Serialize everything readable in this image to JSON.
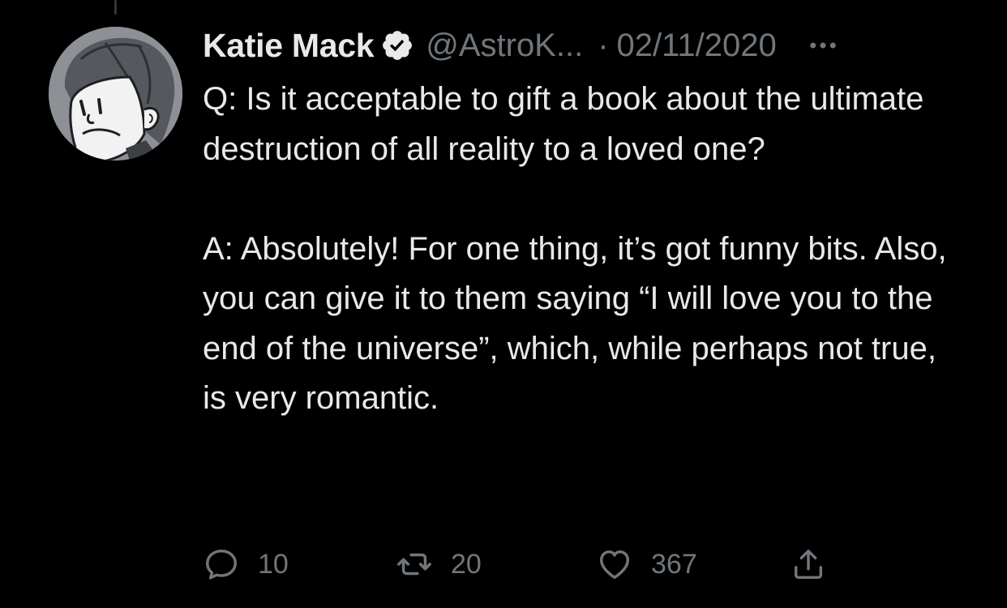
{
  "tweet": {
    "author": {
      "display_name": "Katie Mack",
      "handle": "@AstroK...",
      "verified": true,
      "avatar_icon": "cartoon-avatar"
    },
    "separator": "·",
    "date": "02/11/2020",
    "more_icon": "more-options-icon",
    "text": {
      "line1": "Q: Is it acceptable to gift a book about the ultimate destruction of all reality to a loved one?",
      "line2": "A: Absolutely! For one thing, it’s got funny bits. Also, you can give it to them saying “I will love you to the end of the universe”, which, while perhaps not true, is very romantic."
    },
    "actions": {
      "reply": {
        "icon": "reply-icon",
        "count": "10"
      },
      "retweet": {
        "icon": "retweet-icon",
        "count": "20"
      },
      "like": {
        "icon": "like-icon",
        "count": "367"
      },
      "share": {
        "icon": "share-icon"
      }
    }
  },
  "colors": {
    "background": "#000000",
    "text_primary": "#e7e9ea",
    "text_secondary": "#71767b",
    "thread_line": "#333639"
  }
}
